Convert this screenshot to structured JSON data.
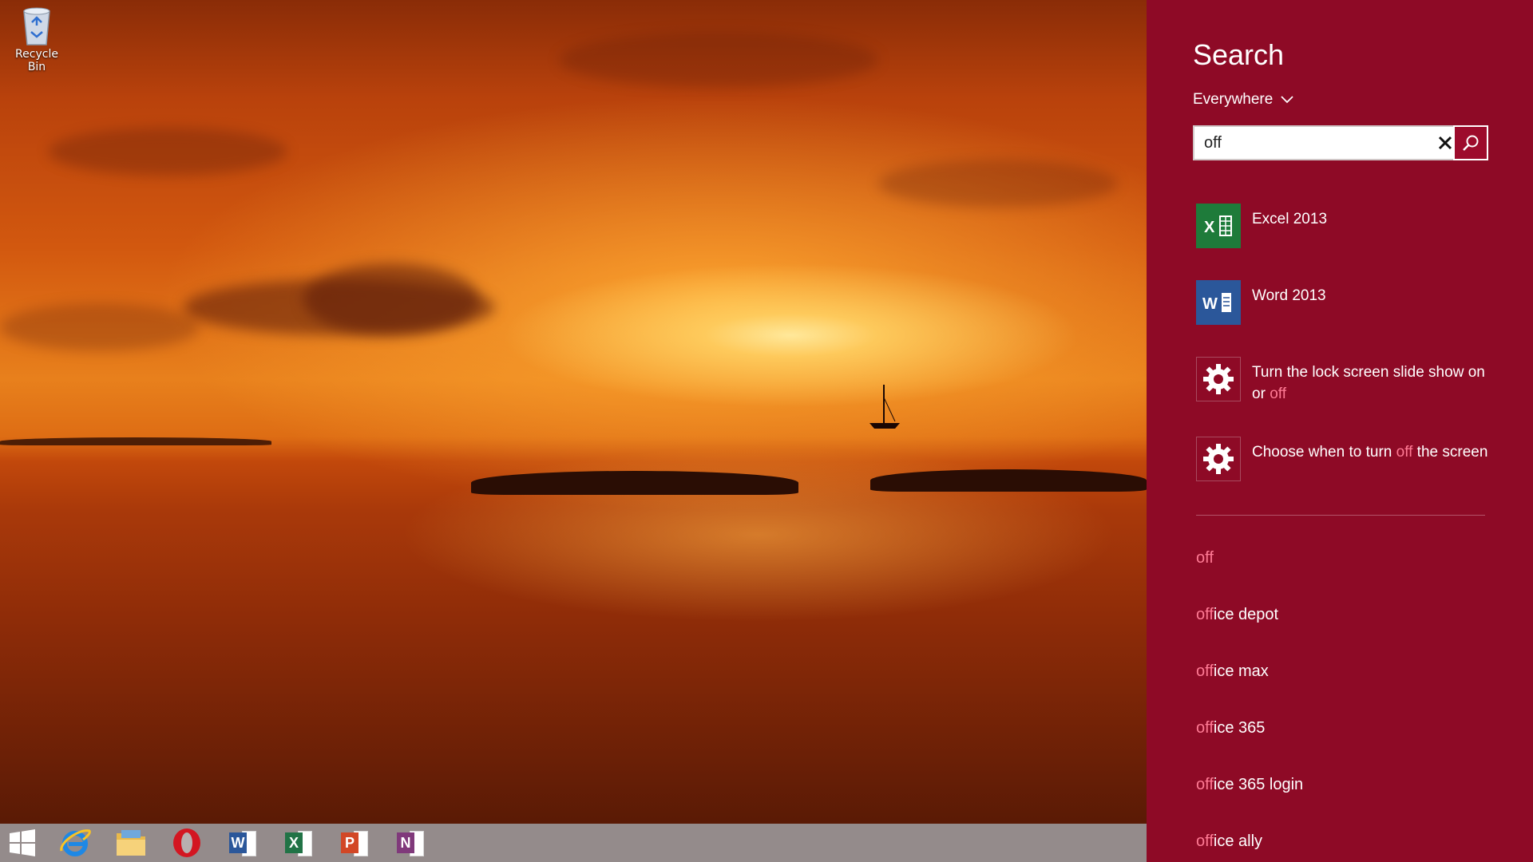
{
  "desktop": {
    "recycle_bin_label": "Recycle Bin"
  },
  "taskbar": {
    "items": [
      {
        "name": "start",
        "icon": "windows-logo-icon"
      },
      {
        "name": "internet-explorer",
        "icon": "internet-explorer-icon"
      },
      {
        "name": "file-explorer",
        "icon": "folder-icon"
      },
      {
        "name": "opera",
        "icon": "opera-icon"
      },
      {
        "name": "word",
        "icon": "word-icon",
        "letter": "W",
        "color": "#2b579a"
      },
      {
        "name": "excel",
        "icon": "excel-icon",
        "letter": "X",
        "color": "#217346"
      },
      {
        "name": "powerpoint",
        "icon": "powerpoint-icon",
        "letter": "P",
        "color": "#d24726"
      },
      {
        "name": "onenote",
        "icon": "onenote-icon",
        "letter": "N",
        "color": "#80397b"
      }
    ]
  },
  "search": {
    "title": "Search",
    "scope": "Everywhere",
    "query": "off",
    "accent_color": "#8e0a26",
    "highlight_color": "#ff7a94",
    "results": [
      {
        "label": "Excel 2013",
        "icon": "excel-icon",
        "tile_letter": "X",
        "tile_color": "#1e7b3a"
      },
      {
        "label": "Word 2013",
        "icon": "word-icon",
        "tile_letter": "W",
        "tile_color": "#2b579a"
      }
    ],
    "settings_results": [
      {
        "before": "Turn the lock screen slide show on or ",
        "match": "off",
        "after": "",
        "icon": "gear-icon"
      },
      {
        "before": "Choose when to turn ",
        "match": "off",
        "after": " the screen",
        "icon": "gear-icon"
      }
    ],
    "suggestions": [
      {
        "match": "off",
        "rest": ""
      },
      {
        "match": "off",
        "rest": "ice depot"
      },
      {
        "match": "off",
        "rest": "ice max"
      },
      {
        "match": "off",
        "rest": "ice 365"
      },
      {
        "match": "off",
        "rest": "ice 365 login"
      },
      {
        "match": "off",
        "rest": "ice ally"
      }
    ]
  }
}
